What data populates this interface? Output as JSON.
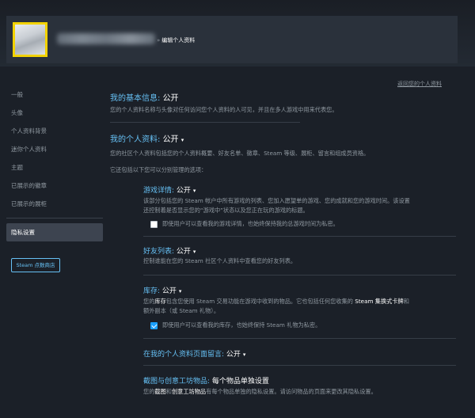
{
  "header": {
    "breadcrumb_sep": "»",
    "breadcrumb_page": "编辑个人资料"
  },
  "sidebar": {
    "items": [
      {
        "label": "一般"
      },
      {
        "label": "头像"
      },
      {
        "label": "个人资料背景"
      },
      {
        "label": "迷你个人资料"
      },
      {
        "label": "主题"
      },
      {
        "label": "已展示的徽章"
      },
      {
        "label": "已展示的展柜"
      }
    ],
    "active_item": "隐私设置",
    "store_button": "Steam 点数商店"
  },
  "main": {
    "return_link": "返回您的个人资料",
    "basic": {
      "title": "我的基本信息:",
      "value": "公开",
      "desc": "您的个人资料名称与头像对任何访问您个人资料的人可见，并且在多人游戏中用来代表您。"
    },
    "profile": {
      "title": "我的个人资料:",
      "value": "公开",
      "desc": "您的社区个人资料包括您的个人资料概要、好友名单、徽章、Steam 等级、展柜、留言和组成员资格。",
      "desc2": "它还包括以下您可以分别管理的选项："
    },
    "game_details": {
      "title": "游戏详情:",
      "value": "公开",
      "desc_line1": "该部分包括您的 Steam 帐户中所有游戏的列表、您加入愿望单的游戏、您的成就和您的游戏时间。该设置",
      "desc_line2": "还控制着是否显示您的“游戏中”状态以及您正在玩的游戏的标题。",
      "checkbox_label": "即使用户可以查看我的游戏详情，也始终保持我的总游戏时间为私密。",
      "checked": false
    },
    "friends": {
      "title": "好友列表:",
      "value": "公开",
      "desc": "控制谁能在您的 Steam 社区个人资料中查看您的好友列表。"
    },
    "inventory": {
      "title": "库存:",
      "value": "公开",
      "desc_a": "您的",
      "desc_b": "库存",
      "desc_c": "包含您使用 Steam 交易功能在游戏中收到的物品。它也包括任何您收集的 ",
      "desc_d": "Steam 集换式卡牌",
      "desc_e": "和",
      "desc_line2": "额外副本（或 Steam 礼物）。",
      "checkbox_label": "即使用户可以查看我的库存，也始终保持 Steam 礼物为私密。",
      "checked": true
    },
    "comments": {
      "title": "在我的个人资料页面留言:",
      "value": "公开"
    },
    "screenshots": {
      "title": "截图与创意工坊物品:",
      "value": "每个物品单独设置",
      "desc_a": "您的",
      "desc_b": "截图",
      "desc_c": "和",
      "desc_d": "创意工坊物品",
      "desc_e": "有每个物品单独的隐私设置。请访问物品的页面来更改其隐私设置。"
    }
  }
}
